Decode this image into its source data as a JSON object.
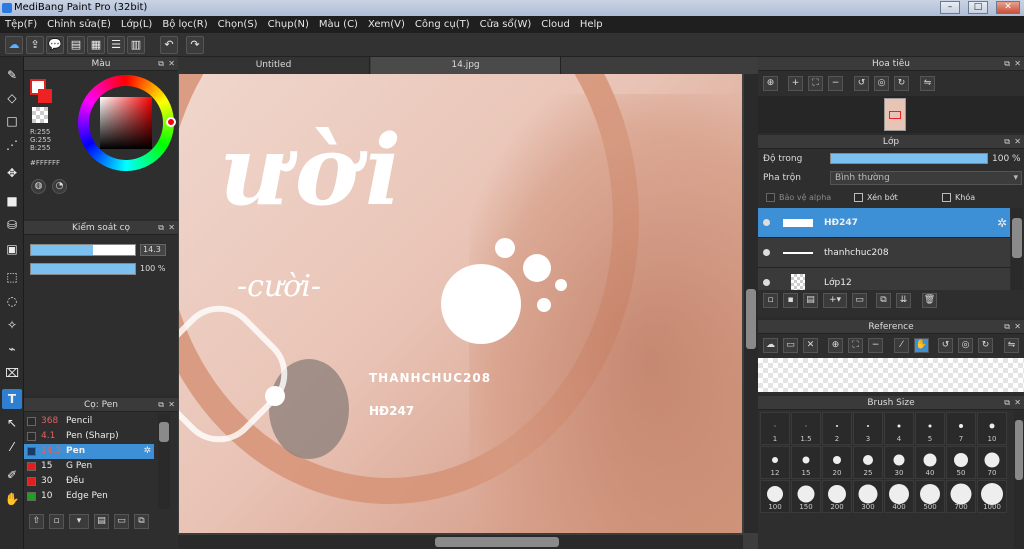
{
  "titlebar": {
    "title": "MediBang Paint Pro (32bit)",
    "min": "–",
    "max": "□",
    "close": "✕"
  },
  "menu": [
    "Tệp(F)",
    "Chỉnh sửa(E)",
    "Lớp(L)",
    "Bộ lọc(R)",
    "Chọn(S)",
    "Chụp(N)",
    "Màu (C)",
    "Xem(V)",
    "Công cụ(T)",
    "Cửa sổ(W)",
    "Cloud",
    "Help"
  ],
  "tabs": {
    "tab1": "Untitled",
    "tab2": "14.jpg"
  },
  "color_panel": {
    "title": "Màu",
    "r": "R:255",
    "g": "G:255",
    "b": "B:255",
    "hex": "#FFFFFF"
  },
  "brush_control": {
    "title": "Kiểm soát cọ",
    "size": "14.3",
    "opacity": "100 %",
    "size_fill": 0.6,
    "opacity_fill": 1.0
  },
  "brush_list": {
    "title": "Cọ: Pen",
    "items": [
      {
        "size": "368",
        "name": "Pencil",
        "color": "#2a2a2a"
      },
      {
        "size": "4.1",
        "name": "Pen (Sharp)",
        "color": "#2a2a2a"
      },
      {
        "size": "14.3",
        "name": "Pen",
        "color": "#1a3a6a"
      },
      {
        "size": "15",
        "name": "G Pen",
        "color": "#e02020"
      },
      {
        "size": "30",
        "name": "Đều",
        "color": "#e02020"
      },
      {
        "size": "10",
        "name": "Edge Pen",
        "color": "#20a020"
      }
    ]
  },
  "navigator": {
    "title": "Hoa tiêu"
  },
  "layers": {
    "title": "Lớp",
    "opacity_label": "Độ trong",
    "opacity_value": "100 %",
    "blend_label": "Pha trộn",
    "blend_value": "Bình thường",
    "protect_alpha": "Bảo vệ alpha",
    "clipping": "Xén bớt",
    "lock": "Khóa",
    "items": [
      {
        "name": "HĐ247"
      },
      {
        "name": "thanhchuc208"
      },
      {
        "name": "Lớp12"
      }
    ]
  },
  "reference": {
    "title": "Reference"
  },
  "brush_size": {
    "title": "Brush Size",
    "sizes": [
      "1",
      "1.5",
      "2",
      "3",
      "4",
      "5",
      "7",
      "10",
      "12",
      "15",
      "20",
      "25",
      "30",
      "40",
      "50",
      "70",
      "100",
      "150",
      "200",
      "300",
      "400",
      "500",
      "700",
      "1000"
    ]
  },
  "canvas_text": {
    "line1": "THANHCHUC208",
    "line2": "HĐ247",
    "cuoi": "-cười-"
  },
  "colors": {
    "accent": "#3d8fd6",
    "canvas_bg": "#e7c9bd"
  }
}
